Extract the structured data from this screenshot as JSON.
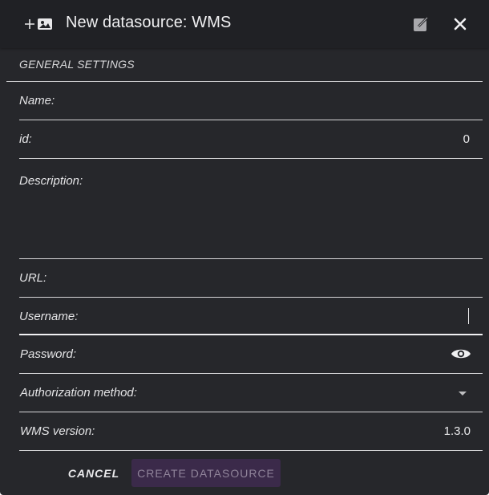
{
  "dialog": {
    "title": "New datasource: WMS",
    "icons": {
      "add": "plus-icon",
      "image": "image-icon",
      "edit": "edit-icon",
      "close": "close-icon"
    }
  },
  "general": {
    "section_title": "GENERAL SETTINGS",
    "name_label": "Name:",
    "name_value": "",
    "id_label": "id:",
    "id_value": "0",
    "description_label": "Description:",
    "description_value": "",
    "url_label": "URL:",
    "url_value": "",
    "username_label": "Username:",
    "username_value": "",
    "password_label": "Password:",
    "password_value": "",
    "auth_label": "Authorization method:",
    "auth_value": "",
    "wms_label": "WMS version:",
    "wms_value": "1.3.0"
  },
  "actions": {
    "cancel_label": "CANCEL",
    "create_label": "CREATE DATASOURCE"
  },
  "colors": {
    "background": "#26272b",
    "header": "#202125",
    "primary_disabled": "#3b2a4a",
    "primary_disabled_text": "#8f8399"
  }
}
